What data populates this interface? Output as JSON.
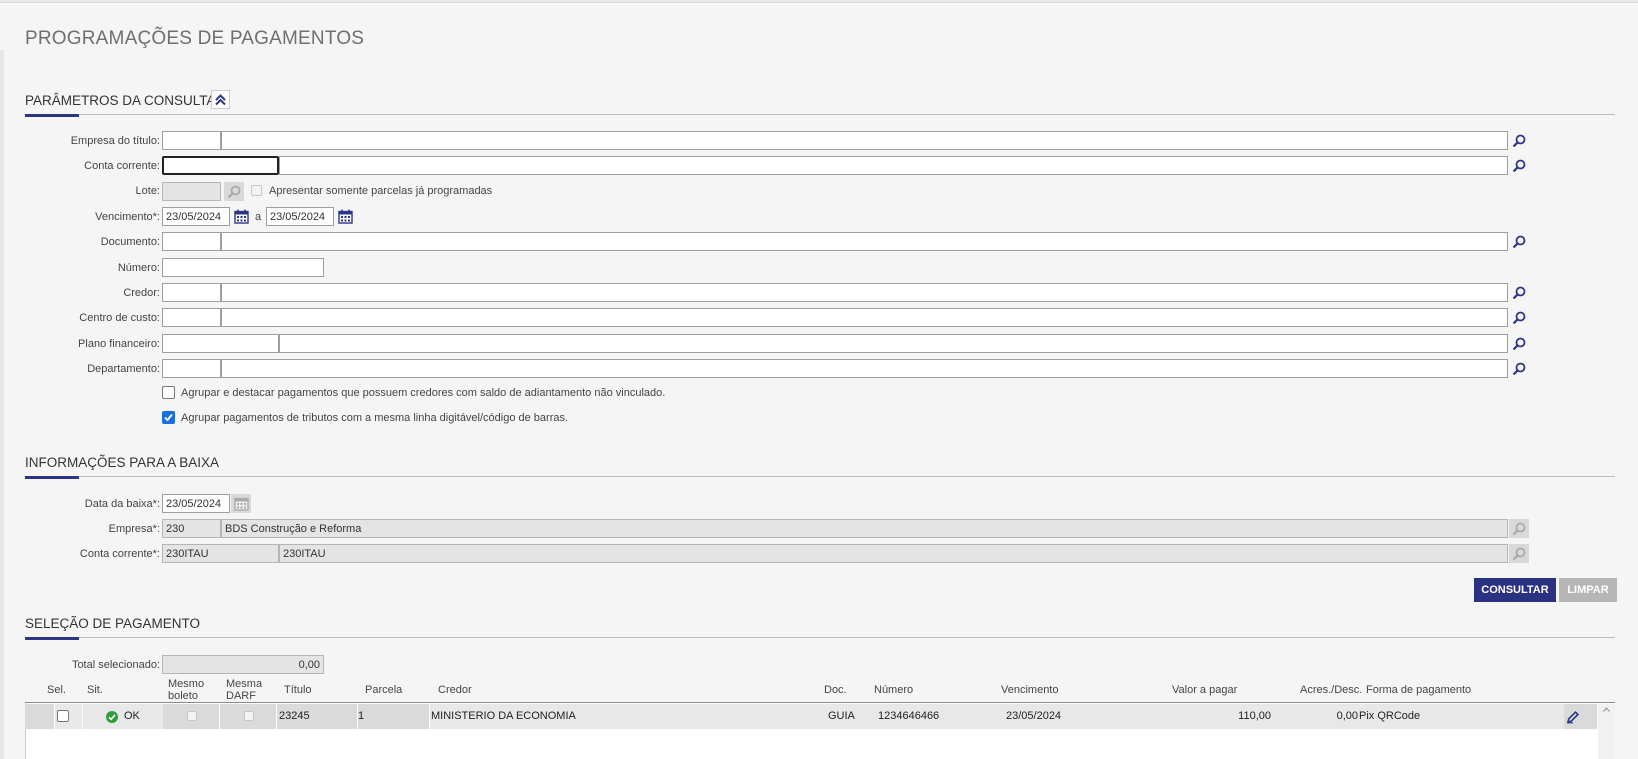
{
  "page": {
    "title": "PROGRAMAÇÕES DE PAGAMENTOS"
  },
  "params": {
    "section_title": "PARÂMETROS DA CONSULTA",
    "empresa_label": "Empresa do título:",
    "conta_label": "Conta corrente:",
    "lote_label": "Lote:",
    "apresentar_label": "Apresentar somente parcelas já programadas",
    "vencimento_label": "Vencimento*:",
    "vencimento_from": "23/05/2024",
    "vencimento_sep": "a",
    "vencimento_to": "23/05/2024",
    "documento_label": "Documento:",
    "numero_label": "Número:",
    "credor_label": "Credor:",
    "centro_label": "Centro de custo:",
    "plano_label": "Plano financeiro:",
    "departamento_label": "Departamento:",
    "agrupar_adiantamento_label": "Agrupar e destacar pagamentos que possuem credores com saldo de adiantamento não vinculado.",
    "agrupar_adiantamento_checked": false,
    "agrupar_tributos_label": "Agrupar pagamentos de tributos com a mesma linha digitável/código de barras.",
    "agrupar_tributos_checked": true
  },
  "baixa": {
    "section_title": "INFORMAÇÕES PARA A BAIXA",
    "data_label": "Data da baixa*:",
    "data_value": "23/05/2024",
    "empresa_label": "Empresa*:",
    "empresa_code": "230",
    "empresa_name": "BDS Construção e Reforma",
    "conta_label": "Conta corrente*:",
    "conta_code": "230ITAU",
    "conta_name": "230ITAU"
  },
  "actions": {
    "consultar": "CONSULTAR",
    "limpar": "LIMPAR"
  },
  "selecao": {
    "section_title": "SELEÇÃO DE PAGAMENTO",
    "total_label": "Total selecionado:",
    "total_value": "0,00"
  },
  "table": {
    "headers": {
      "sel": "Sel.",
      "sit": "Sit.",
      "mesmo_boleto_1": "Mesmo",
      "mesmo_boleto_2": "boleto",
      "mesma_darf_1": "Mesma",
      "mesma_darf_2": "DARF",
      "titulo": "Título",
      "parcela": "Parcela",
      "credor": "Credor",
      "doc": "Doc.",
      "numero": "Número",
      "vencimento": "Vencimento",
      "valor": "Valor a pagar",
      "acres": "Acres./Desc.",
      "forma": "Forma de pagamento"
    },
    "rows": [
      {
        "status": "OK",
        "titulo": "23245",
        "parcela": "1",
        "credor": "MINISTERIO DA ECONOMIA",
        "doc": "GUIA",
        "numero": "1234646466",
        "vencimento": "23/05/2024",
        "valor": "110,00",
        "acres": "0,00",
        "forma": "Pix QRCode"
      }
    ]
  },
  "colors": {
    "accent": "#2b3181",
    "ok": "#2e9e3e",
    "icon": "#2d3586"
  }
}
